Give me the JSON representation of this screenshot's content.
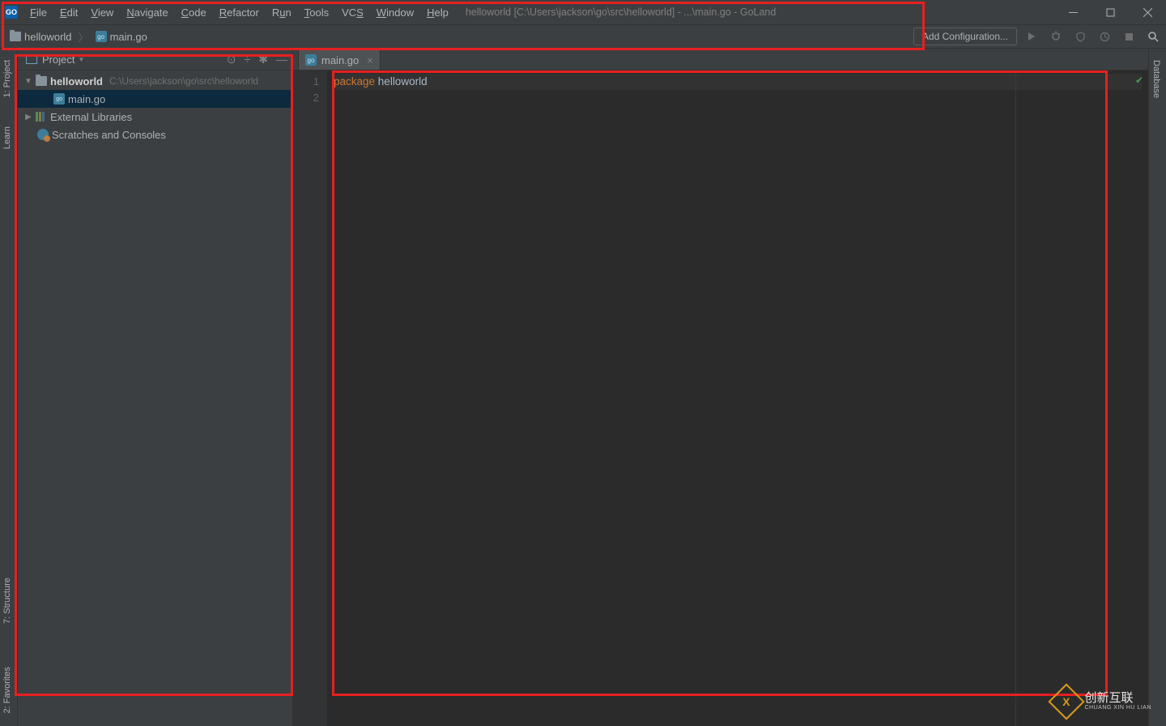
{
  "titlebar": {
    "app_icon": "GO",
    "title": "helloworld [C:\\Users\\jackson\\go\\src\\helloworld] - ...\\main.go - GoLand"
  },
  "menu": {
    "file": "File",
    "edit": "Edit",
    "view": "View",
    "navigate": "Navigate",
    "code": "Code",
    "refactor": "Refactor",
    "run": "Run",
    "tools": "Tools",
    "vcs": "VCS",
    "window": "Window",
    "help": "Help"
  },
  "breadcrumb": {
    "project": "helloworld",
    "file": "main.go"
  },
  "navbar": {
    "add_config": "Add Configuration..."
  },
  "side_tabs": {
    "project": "1: Project",
    "learn": "Learn",
    "structure": "7: Structure",
    "favorites": "2: Favorites",
    "database": "Database"
  },
  "project_panel": {
    "title": "Project",
    "root": "helloworld",
    "root_path": "C:\\Users\\jackson\\go\\src\\helloworld",
    "file1": "main.go",
    "ext_libs": "External Libraries",
    "scratches": "Scratches and Consoles"
  },
  "editor": {
    "tab1": "main.go",
    "line1_kw": "package",
    "line1_id": " helloworld",
    "gutter": [
      "1",
      "2"
    ]
  },
  "watermark": {
    "badge": "X",
    "text": "创新互联",
    "sub": "CHUANG XIN HU LIAN"
  }
}
